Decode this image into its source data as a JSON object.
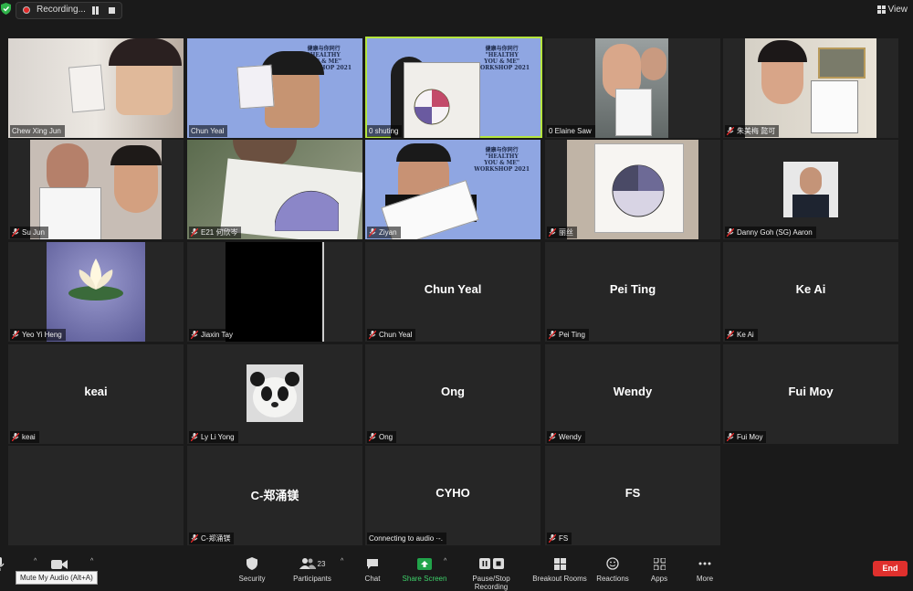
{
  "recording": {
    "label": "Recording..."
  },
  "view": {
    "label": "View"
  },
  "tiles": [
    {
      "name": "Chew Xing Jun",
      "muted": false
    },
    {
      "name": "Chun Yeal",
      "muted": false
    },
    {
      "name": "0 shuting",
      "muted": false
    },
    {
      "name": "0 Elaine Saw",
      "muted": false
    },
    {
      "name": "朱美梅 懿可",
      "muted": true
    },
    {
      "name": "Su Jun",
      "muted": true
    },
    {
      "name": "E21 何欣岑",
      "muted": true
    },
    {
      "name": "Ziyan",
      "muted": true
    },
    {
      "name": "丽丝",
      "muted": true
    },
    {
      "name": "Danny Goh (SG) Aaron",
      "muted": true
    },
    {
      "name": "Yeo Yi Heng",
      "muted": true
    },
    {
      "name": "Jiaxin Tay",
      "muted": true
    },
    {
      "name": "Chun Yeal",
      "center": "Chun Yeal",
      "muted": true
    },
    {
      "name": "Pei Ting",
      "center": "Pei Ting",
      "muted": true
    },
    {
      "name": "Ke Ai",
      "center": "Ke Ai",
      "muted": true
    },
    {
      "name": "keai",
      "center": "keai",
      "muted": true
    },
    {
      "name": "Ly Li Yong",
      "muted": true
    },
    {
      "name": "Ong",
      "center": "Ong",
      "muted": true
    },
    {
      "name": "Wendy",
      "center": "Wendy",
      "muted": true
    },
    {
      "name": "Fui Moy",
      "center": "Fui Moy",
      "muted": true
    },
    {
      "name": "C-郑涌镁",
      "center": "C-郑涌镁",
      "muted": true
    },
    {
      "name": "Connecting to audio ·-.",
      "center": "CYHO",
      "muted": false
    },
    {
      "name": "FS",
      "center": "FS",
      "muted": true
    }
  ],
  "banner": {
    "line1": "健康与你同行",
    "line2": "\"HEALTHY",
    "line3": "YOU & ME\"",
    "line4": "WORKSHOP 2021"
  },
  "toolbar": {
    "security": "Security",
    "participants": "Participants",
    "participants_count": "23",
    "chat": "Chat",
    "share": "Share Screen",
    "record": "Pause/Stop Recording",
    "breakout": "Breakout Rooms",
    "reactions": "Reactions",
    "apps": "Apps",
    "more": "More",
    "end": "End"
  },
  "tooltip": "Mute My Audio (Alt+A)",
  "colors": {
    "active_border": "#b5e53e",
    "end": "#e0302d",
    "share": "#21a34a"
  }
}
